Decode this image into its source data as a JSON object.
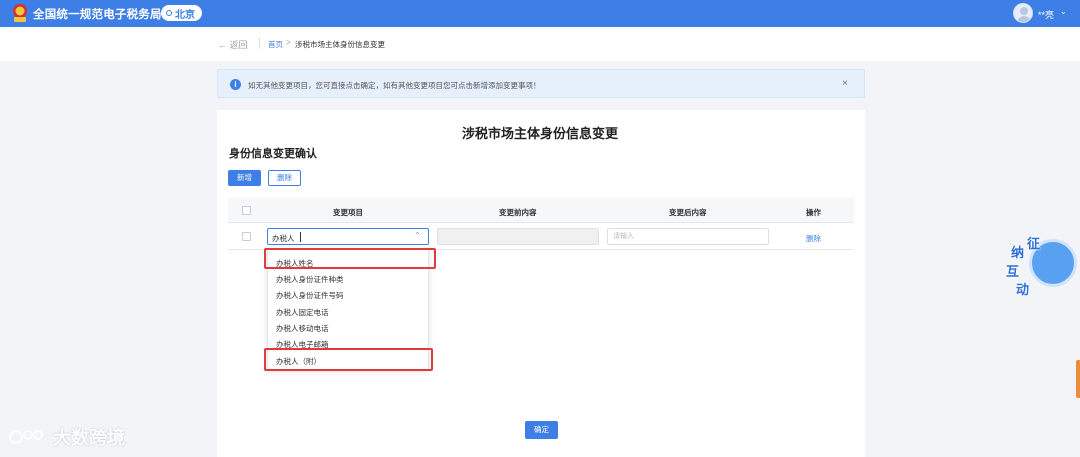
{
  "header": {
    "site_title": "全国统一规范电子税务局",
    "region": "北京",
    "user_name": "**亮",
    "brand_color": "#3d7fe6"
  },
  "breadcrumb": {
    "back_label": "返回",
    "home": "首页",
    "separator": ">",
    "current": "涉税市场主体身份信息变更"
  },
  "notice": {
    "text": "如无其他变更项目，您可直接点击确定，如有其他变更项目您可点击新增添加变更事项！",
    "close": "×"
  },
  "page": {
    "title": "涉税市场主体身份信息变更",
    "section_title": "身份信息变更确认"
  },
  "toolbar": {
    "add_label": "新增",
    "delete_label": "删除"
  },
  "table": {
    "columns": [
      "变更项目",
      "变更前内容",
      "变更后内容",
      "操作"
    ],
    "row": {
      "item_value": "办税人",
      "after_placeholder": "请输入",
      "action": "删除"
    }
  },
  "dropdown": {
    "options": [
      "办税人姓名",
      "办税人身份证件种类",
      "办税人身份证件号码",
      "办税人固定电话",
      "办税人移动电话",
      "办税人电子邮箱",
      "办税人（附）"
    ],
    "highlighted": [
      "办税人姓名",
      "办税人（附）"
    ],
    "highlight_color": "#e03a3a"
  },
  "footer": {
    "confirm_label": "确定"
  },
  "watermark": {
    "text": "大数跨境"
  },
  "assistant": {
    "chars": [
      "征",
      "纳",
      "互",
      "动"
    ]
  }
}
